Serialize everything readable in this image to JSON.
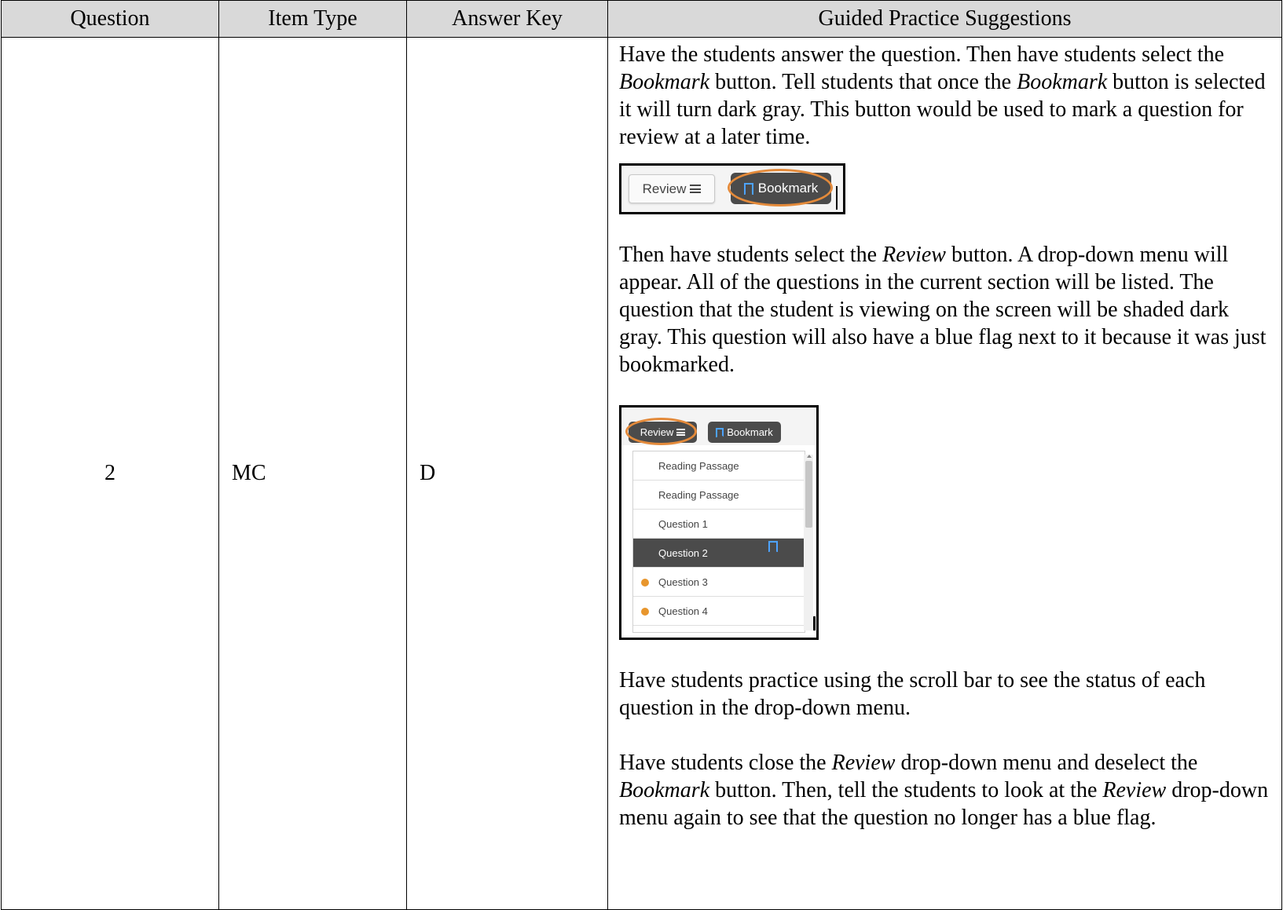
{
  "table": {
    "headers": [
      "Question",
      "Item Type",
      "Answer Key",
      "Guided Practice Suggestions"
    ],
    "row": {
      "question": "2",
      "item_type": "MC",
      "answer_key": "D"
    }
  },
  "guide": {
    "p1": {
      "a": "Have the students answer the question.  Then have students select the ",
      "b": "Bookmark",
      "c": " button.  Tell students that once the ",
      "d": "Bookmark",
      "e": " button is selected it will turn dark gray. This button would be used to mark a question for review at a later time."
    },
    "p2": {
      "a": "Then have students select the ",
      "b": "Review",
      "c": " button. A drop-down menu will appear. All of the questions in the current section will be listed.  The question that the student is viewing on the screen will be shaded dark gray. This question will also have a blue flag next to it because it was just bookmarked."
    },
    "p3": "Have students practice using the scroll bar to see the status of each question in the drop-down menu.",
    "p4": {
      "a": "Have students close the ",
      "b": "Review",
      "c": " drop-down menu and deselect the ",
      "d": "Bookmark",
      "e": " button. Then, tell the students to look at the ",
      "f": "Review",
      "g": " drop-down menu again to see that the question no longer has a blue flag."
    }
  },
  "screenshot1": {
    "review_label": "Review",
    "bookmark_label": "Bookmark"
  },
  "screenshot2": {
    "review_label": "Review",
    "bookmark_label": "Bookmark",
    "items": [
      "Reading Passage",
      "Reading Passage",
      "Question 1",
      "Question 2",
      "Question 3",
      "Question 4"
    ]
  },
  "colors": {
    "header_bg": "#d9d9d9",
    "highlight_ring": "#e48a3a",
    "selected_button": "#4b4b4b",
    "bookmark_flag": "#4da3ff",
    "status_dot": "#e8962d"
  }
}
